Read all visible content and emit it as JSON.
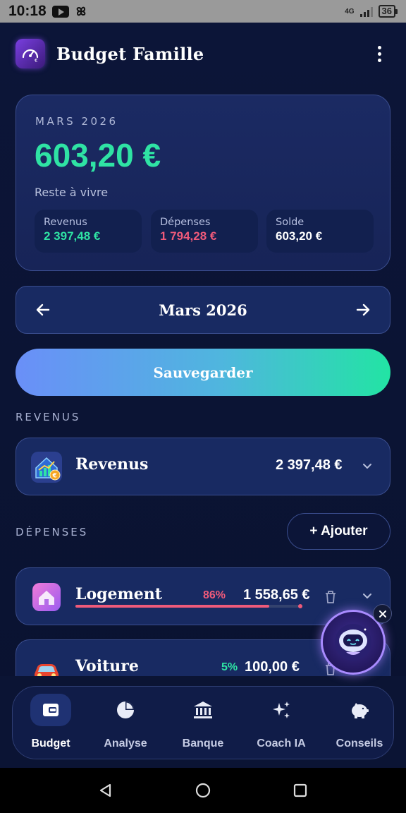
{
  "status_bar": {
    "time": "10:18",
    "network": "4G",
    "battery": "36"
  },
  "header": {
    "title": "Budget Famille"
  },
  "summary": {
    "month_label": "MARS 2026",
    "remaining": "603,20 €",
    "remaining_label": "Reste à vivre",
    "revenus": {
      "label": "Revenus",
      "value": "2 397,48 €",
      "color": "#2fe3a4"
    },
    "depenses": {
      "label": "Dépenses",
      "value": "1 794,28 €",
      "color": "#ef5a7a"
    },
    "solde": {
      "label": "Solde",
      "value": "603,20 €",
      "color": "#ffffff"
    }
  },
  "month_nav": {
    "title": "Mars 2026"
  },
  "save_button": {
    "label": "Sauvegarder"
  },
  "sections": {
    "revenus": "REVENUS",
    "depenses": "DÉPENSES"
  },
  "revenus_card": {
    "name": "Revenus",
    "amount": "2 397,48 €"
  },
  "add_button": {
    "label": "+ Ajouter"
  },
  "expenses": [
    {
      "name": "Logement",
      "percent": "86%",
      "amount": "1 558,65 €",
      "percent_color": "#ef5a7a",
      "progress": 0.86
    },
    {
      "name": "Voiture",
      "percent": "5%",
      "amount": "100,00 €",
      "percent_color": "#2fe3a4",
      "progress": 0.05
    }
  ],
  "bottom_nav": [
    {
      "label": "Budget",
      "icon": "wallet-icon",
      "active": true
    },
    {
      "label": "Analyse",
      "icon": "pie-chart-icon"
    },
    {
      "label": "Banque",
      "icon": "bank-icon"
    },
    {
      "label": "Coach IA",
      "icon": "sparkles-icon"
    },
    {
      "label": "Conseils",
      "icon": "piggy-bank-icon"
    }
  ],
  "colors": {
    "accent_green": "#2fe3a4",
    "accent_red": "#ef5a7a",
    "background": "#0b1233",
    "card": "#182a62"
  }
}
